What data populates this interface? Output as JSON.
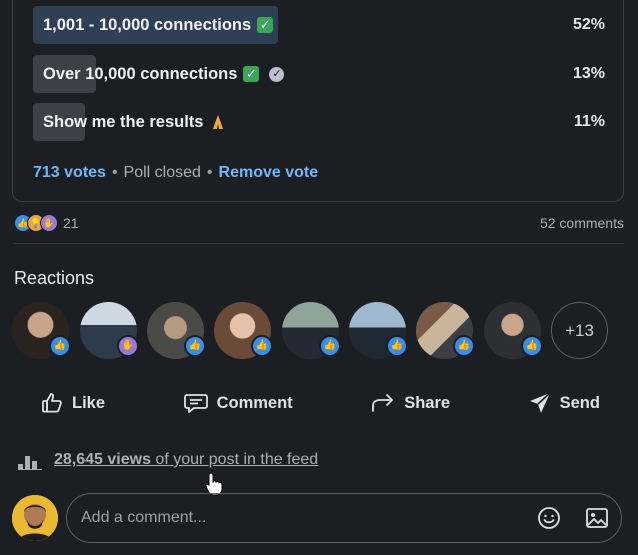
{
  "poll": {
    "options": [
      {
        "label": "1,001 - 10,000 connections",
        "percent": "52%",
        "selected": true,
        "bar_fraction": 0.43
      },
      {
        "label": "Over 10,000 connections",
        "percent": "13%",
        "selected": false,
        "bar_fraction": 0.11
      },
      {
        "label": "Show me the results",
        "percent": "11%",
        "selected": false,
        "bar_fraction": 0.09
      }
    ],
    "votes": "713 votes",
    "status": "Poll closed",
    "remove_vote": "Remove vote",
    "separator": "•"
  },
  "social": {
    "reaction_count": "21",
    "comments": "52 comments"
  },
  "reactions": {
    "title": "Reactions",
    "more": "+13"
  },
  "actions": {
    "like": "Like",
    "comment": "Comment",
    "share": "Share",
    "send": "Send"
  },
  "views": {
    "count": "28,645 views",
    "suffix": "of your post in the feed"
  },
  "comment_box": {
    "placeholder": "Add a comment..."
  },
  "colors": {
    "background": "#1b1f23",
    "link": "#71b7fb",
    "like_badge": "#378fe9",
    "celebrate_badge": "#9b7ad6"
  }
}
